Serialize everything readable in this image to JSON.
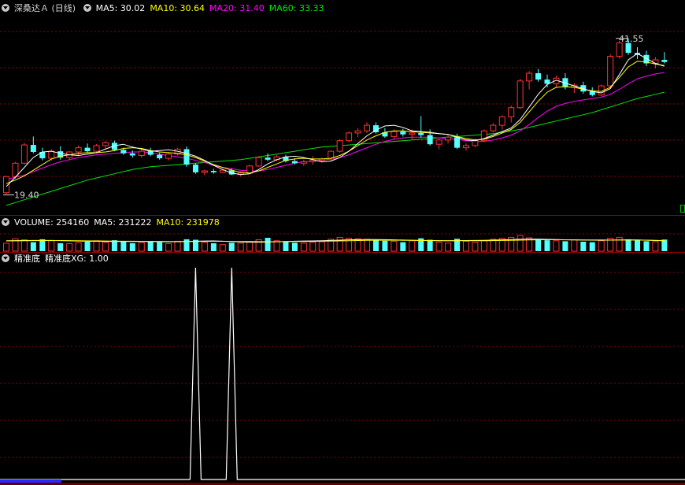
{
  "price_header": {
    "title": "深桑达Ａ (日线)",
    "ma5": "MA5: 30.02",
    "ma10": "MA10: 30.64",
    "ma20": "MA20: 31.40",
    "ma60": "MA60: 33.33"
  },
  "volume_header": {
    "volume": "VOLUME: 254160",
    "ma5": "MA5: 231222",
    "ma10": "MA10: 231978"
  },
  "indicator_header": {
    "name": "精准底",
    "value": "精准底XG: 1.00"
  },
  "annotations": {
    "high_label": "41.55",
    "low_label": "19.40"
  },
  "colors": {
    "up": "#ff3232",
    "down": "#54ffff",
    "ma5": "#ffffff",
    "ma10": "#ffff00",
    "ma20": "#ff00ff",
    "ma60": "#00e600",
    "grid": "#8b0000",
    "separator": "#a00000",
    "indicator": "#ffffff"
  },
  "chart_data": [
    {
      "type": "candlestick",
      "title": "深桑达Ａ (日线)",
      "series": [
        {
          "name": "MA5",
          "values": [
            20.5,
            21.8,
            23.2,
            24.6,
            25.4,
            25.5,
            25.2,
            25.0,
            24.9,
            25.1,
            25.3,
            25.8,
            26.3,
            26.5,
            26.1,
            25.8,
            25.5,
            25.6,
            25.7,
            25.5,
            25.2,
            24.8,
            24.2,
            23.5,
            22.9,
            22.4,
            22.2,
            22.3,
            22.9,
            23.7,
            24.3,
            24.7,
            24.8,
            24.6,
            24.3,
            24.0,
            24.1,
            24.6,
            25.5,
            26.6,
            27.7,
            28.5,
            29.1,
            29.2,
            28.9,
            28.4,
            28.3,
            28.2,
            28.0,
            27.9,
            27.5,
            27.1,
            27.0,
            27.3,
            27.8,
            28.3,
            28.8,
            30.0,
            31.8,
            33.6,
            35.0,
            35.6,
            35.2,
            34.8,
            34.4,
            34.0,
            33.8,
            34.4,
            36.4,
            38.5,
            39.4,
            38.7,
            38.0,
            37.6
          ]
        },
        {
          "name": "MA10",
          "values": [
            20.9,
            21.4,
            22.0,
            22.8,
            23.6,
            24.4,
            24.8,
            25.0,
            25.2,
            25.3,
            25.3,
            25.4,
            25.6,
            25.9,
            26.0,
            25.9,
            25.6,
            25.4,
            25.3,
            25.2,
            25.0,
            24.6,
            24.1,
            23.6,
            23.2,
            22.8,
            22.5,
            22.4,
            22.7,
            23.2,
            23.7,
            24.2,
            24.4,
            24.5,
            24.4,
            24.4,
            24.5,
            24.9,
            25.5,
            26.3,
            27.1,
            27.7,
            28.2,
            28.4,
            28.4,
            28.3,
            28.2,
            28.1,
            28.0,
            27.9,
            27.6,
            27.3,
            27.1,
            27.2,
            27.6,
            28.1,
            28.6,
            29.6,
            31.1,
            32.6,
            33.9,
            34.6,
            34.7,
            34.6,
            34.3,
            34.1,
            34.0,
            34.6,
            36.0,
            37.5,
            38.3,
            38.2,
            37.9,
            37.7
          ]
        },
        {
          "name": "MA20",
          "values": [
            21.5,
            21.8,
            22.1,
            22.6,
            23.1,
            23.6,
            24.0,
            24.3,
            24.6,
            24.8,
            25.0,
            25.1,
            25.2,
            25.3,
            25.4,
            25.4,
            25.3,
            25.1,
            24.9,
            24.7,
            24.5,
            24.2,
            23.9,
            23.5,
            23.2,
            23.0,
            22.8,
            22.7,
            22.7,
            22.9,
            23.2,
            23.5,
            23.8,
            24.0,
            24.1,
            24.2,
            24.4,
            24.6,
            25.0,
            25.5,
            26.0,
            26.5,
            26.9,
            27.2,
            27.4,
            27.5,
            27.5,
            27.5,
            27.4,
            27.3,
            27.2,
            27.0,
            26.9,
            26.9,
            27.1,
            27.4,
            27.8,
            28.4,
            29.3,
            30.3,
            31.2,
            31.9,
            32.3,
            32.6,
            32.8,
            33.0,
            33.2,
            33.6,
            34.3,
            35.1,
            35.8,
            36.2,
            36.5,
            36.7
          ]
        },
        {
          "name": "MA60",
          "values": [
            17.8,
            18.2,
            18.6,
            19.0,
            19.4,
            19.8,
            20.2,
            20.6,
            21.0,
            21.4,
            21.7,
            22.0,
            22.3,
            22.6,
            22.9,
            23.1,
            23.3,
            23.4,
            23.5,
            23.6,
            23.7,
            23.8,
            23.9,
            24.0,
            24.1,
            24.2,
            24.3,
            24.5,
            24.7,
            24.9,
            25.1,
            25.3,
            25.5,
            25.7,
            25.9,
            26.1,
            26.2,
            26.3,
            26.4,
            26.5,
            26.6,
            26.7,
            26.8,
            26.9,
            27.0,
            27.1,
            27.2,
            27.3,
            27.4,
            27.5,
            27.6,
            27.7,
            27.8,
            27.9,
            28.0,
            28.2,
            28.4,
            28.6,
            28.9,
            29.2,
            29.5,
            29.8,
            30.1,
            30.4,
            30.7,
            31.0,
            31.4,
            31.8,
            32.2,
            32.6,
            33.0,
            33.3,
            33.6,
            33.9
          ]
        }
      ],
      "ohlc": [
        [
          19.6,
          22.0,
          19.4,
          21.9
        ],
        [
          21.9,
          24.0,
          21.6,
          23.8
        ],
        [
          23.8,
          26.7,
          23.6,
          26.4
        ],
        [
          26.4,
          27.6,
          25.2,
          25.4
        ],
        [
          25.4,
          26.0,
          24.2,
          24.5
        ],
        [
          24.5,
          25.8,
          24.2,
          25.5
        ],
        [
          25.5,
          26.2,
          24.3,
          24.6
        ],
        [
          24.6,
          25.5,
          24.2,
          25.4
        ],
        [
          25.4,
          26.3,
          24.9,
          26.0
        ],
        [
          26.0,
          26.6,
          25.3,
          25.5
        ],
        [
          25.5,
          26.5,
          25.2,
          26.3
        ],
        [
          26.3,
          27.0,
          25.8,
          26.7
        ],
        [
          26.7,
          27.0,
          25.5,
          25.7
        ],
        [
          25.7,
          26.0,
          25.0,
          25.2
        ],
        [
          25.2,
          25.6,
          24.6,
          24.9
        ],
        [
          24.9,
          25.7,
          24.6,
          25.5
        ],
        [
          25.5,
          26.0,
          24.8,
          25.0
        ],
        [
          25.0,
          25.3,
          24.3,
          24.5
        ],
        [
          24.5,
          25.4,
          24.2,
          25.1
        ],
        [
          25.1,
          26.0,
          24.9,
          25.8
        ],
        [
          25.8,
          26.2,
          23.3,
          23.6
        ],
        [
          23.6,
          23.8,
          22.3,
          22.5
        ],
        [
          22.5,
          22.9,
          22.1,
          22.7
        ],
        [
          22.7,
          23.0,
          22.3,
          22.5
        ],
        [
          22.5,
          23.0,
          22.4,
          22.8
        ],
        [
          22.8,
          23.1,
          22.1,
          22.2
        ],
        [
          22.2,
          22.6,
          21.9,
          22.4
        ],
        [
          22.4,
          23.6,
          22.3,
          23.4
        ],
        [
          23.4,
          24.8,
          23.3,
          24.6
        ],
        [
          24.6,
          25.2,
          24.1,
          24.3
        ],
        [
          24.3,
          25.0,
          24.1,
          24.7
        ],
        [
          24.7,
          25.0,
          23.9,
          24.1
        ],
        [
          24.1,
          24.5,
          23.6,
          23.8
        ],
        [
          23.8,
          24.3,
          23.4,
          24.0
        ],
        [
          24.0,
          24.8,
          23.6,
          24.2
        ],
        [
          24.2,
          24.6,
          23.9,
          24.4
        ],
        [
          24.4,
          25.6,
          24.2,
          25.5
        ],
        [
          25.5,
          27.2,
          25.3,
          27.0
        ],
        [
          27.0,
          28.3,
          26.8,
          28.1
        ],
        [
          28.1,
          28.8,
          27.5,
          28.4
        ],
        [
          28.4,
          29.6,
          28.1,
          29.2
        ],
        [
          29.2,
          29.6,
          28.0,
          28.2
        ],
        [
          28.2,
          28.8,
          27.4,
          27.6
        ],
        [
          27.6,
          28.6,
          27.3,
          28.3
        ],
        [
          28.3,
          28.7,
          27.6,
          27.9
        ],
        [
          27.9,
          28.6,
          27.2,
          28.1
        ],
        [
          28.1,
          30.5,
          27.4,
          27.8
        ],
        [
          27.8,
          28.6,
          26.3,
          26.5
        ],
        [
          26.5,
          27.3,
          25.8,
          27.1
        ],
        [
          27.1,
          27.9,
          26.6,
          27.5
        ],
        [
          27.5,
          28.0,
          25.8,
          26.0
        ],
        [
          26.0,
          26.6,
          25.6,
          26.3
        ],
        [
          26.3,
          27.3,
          26.1,
          27.0
        ],
        [
          27.0,
          28.6,
          26.8,
          28.4
        ],
        [
          28.4,
          29.5,
          28.2,
          29.2
        ],
        [
          29.2,
          30.6,
          28.6,
          30.4
        ],
        [
          30.4,
          32.0,
          29.6,
          31.7
        ],
        [
          31.7,
          35.8,
          31.5,
          35.5
        ],
        [
          35.5,
          36.9,
          34.3,
          36.6
        ],
        [
          36.6,
          37.2,
          35.4,
          35.7
        ],
        [
          35.7,
          36.4,
          34.6,
          35.1
        ],
        [
          35.1,
          36.3,
          34.5,
          35.9
        ],
        [
          35.9,
          36.6,
          34.3,
          34.6
        ],
        [
          34.6,
          35.2,
          33.8,
          34.9
        ],
        [
          34.9,
          35.4,
          33.7,
          34.0
        ],
        [
          34.0,
          34.6,
          33.3,
          33.5
        ],
        [
          33.5,
          35.0,
          33.3,
          34.8
        ],
        [
          34.8,
          39.3,
          34.5,
          39.0
        ],
        [
          39.0,
          41.2,
          38.7,
          40.9
        ],
        [
          40.9,
          41.55,
          39.2,
          39.5
        ],
        [
          39.5,
          40.3,
          38.6,
          39.2
        ],
        [
          39.2,
          39.8,
          37.6,
          38.0
        ],
        [
          38.0,
          38.9,
          37.3,
          38.5
        ],
        [
          38.5,
          39.6,
          38.0,
          38.2
        ]
      ]
    },
    {
      "type": "bar",
      "series": [
        {
          "name": "VOLUME",
          "values": [
            180,
            270,
            250,
            200,
            260,
            230,
            180,
            170,
            190,
            210,
            230,
            200,
            240,
            210,
            180,
            190,
            210,
            200,
            170,
            220,
            260,
            250,
            200,
            180,
            150,
            190,
            180,
            210,
            250,
            290,
            230,
            220,
            190,
            180,
            200,
            210,
            260,
            300,
            280,
            270,
            260,
            240,
            230,
            220,
            200,
            230,
            280,
            250,
            200,
            180,
            270,
            220,
            200,
            230,
            260,
            280,
            300,
            340,
            290,
            260,
            240,
            230,
            220,
            250,
            210,
            200,
            230,
            280,
            300,
            260,
            240,
            220,
            210,
            254.16
          ]
        },
        {
          "name": "MA5",
          "values": [
            230,
            232,
            234,
            236,
            236,
            236,
            232,
            228,
            224,
            220,
            218,
            216,
            214,
            214,
            214,
            214,
            212,
            210,
            208,
            210,
            214,
            220,
            224,
            226,
            220,
            214,
            206,
            200,
            200,
            204,
            208,
            214,
            220,
            224,
            226,
            230,
            236,
            242,
            248,
            252,
            254,
            254,
            252,
            248,
            244,
            240,
            236,
            234,
            232,
            230,
            232,
            234,
            236,
            238,
            242,
            248,
            254,
            260,
            264,
            262,
            258,
            254,
            250,
            246,
            244,
            242,
            240,
            242,
            246,
            248,
            246,
            240,
            234,
            231.222
          ]
        },
        {
          "name": "MA10",
          "values": [
            226,
            228,
            230,
            232,
            233,
            234,
            234,
            232,
            230,
            228,
            226,
            224,
            222,
            220,
            219,
            218,
            217,
            216,
            215,
            214,
            214,
            215,
            216,
            218,
            218,
            217,
            215,
            213,
            211,
            210,
            210,
            211,
            213,
            215,
            217,
            219,
            222,
            226,
            230,
            234,
            238,
            240,
            241,
            240,
            239,
            237,
            235,
            233,
            231,
            230,
            229,
            229,
            230,
            231,
            233,
            236,
            239,
            243,
            247,
            249,
            250,
            250,
            249,
            248,
            247,
            246,
            245,
            244,
            244,
            244,
            244,
            242,
            238,
            231.978
          ]
        }
      ]
    },
    {
      "type": "line",
      "series": [
        {
          "name": "精准底XG",
          "signal_days": [
            21,
            25
          ]
        }
      ]
    }
  ]
}
